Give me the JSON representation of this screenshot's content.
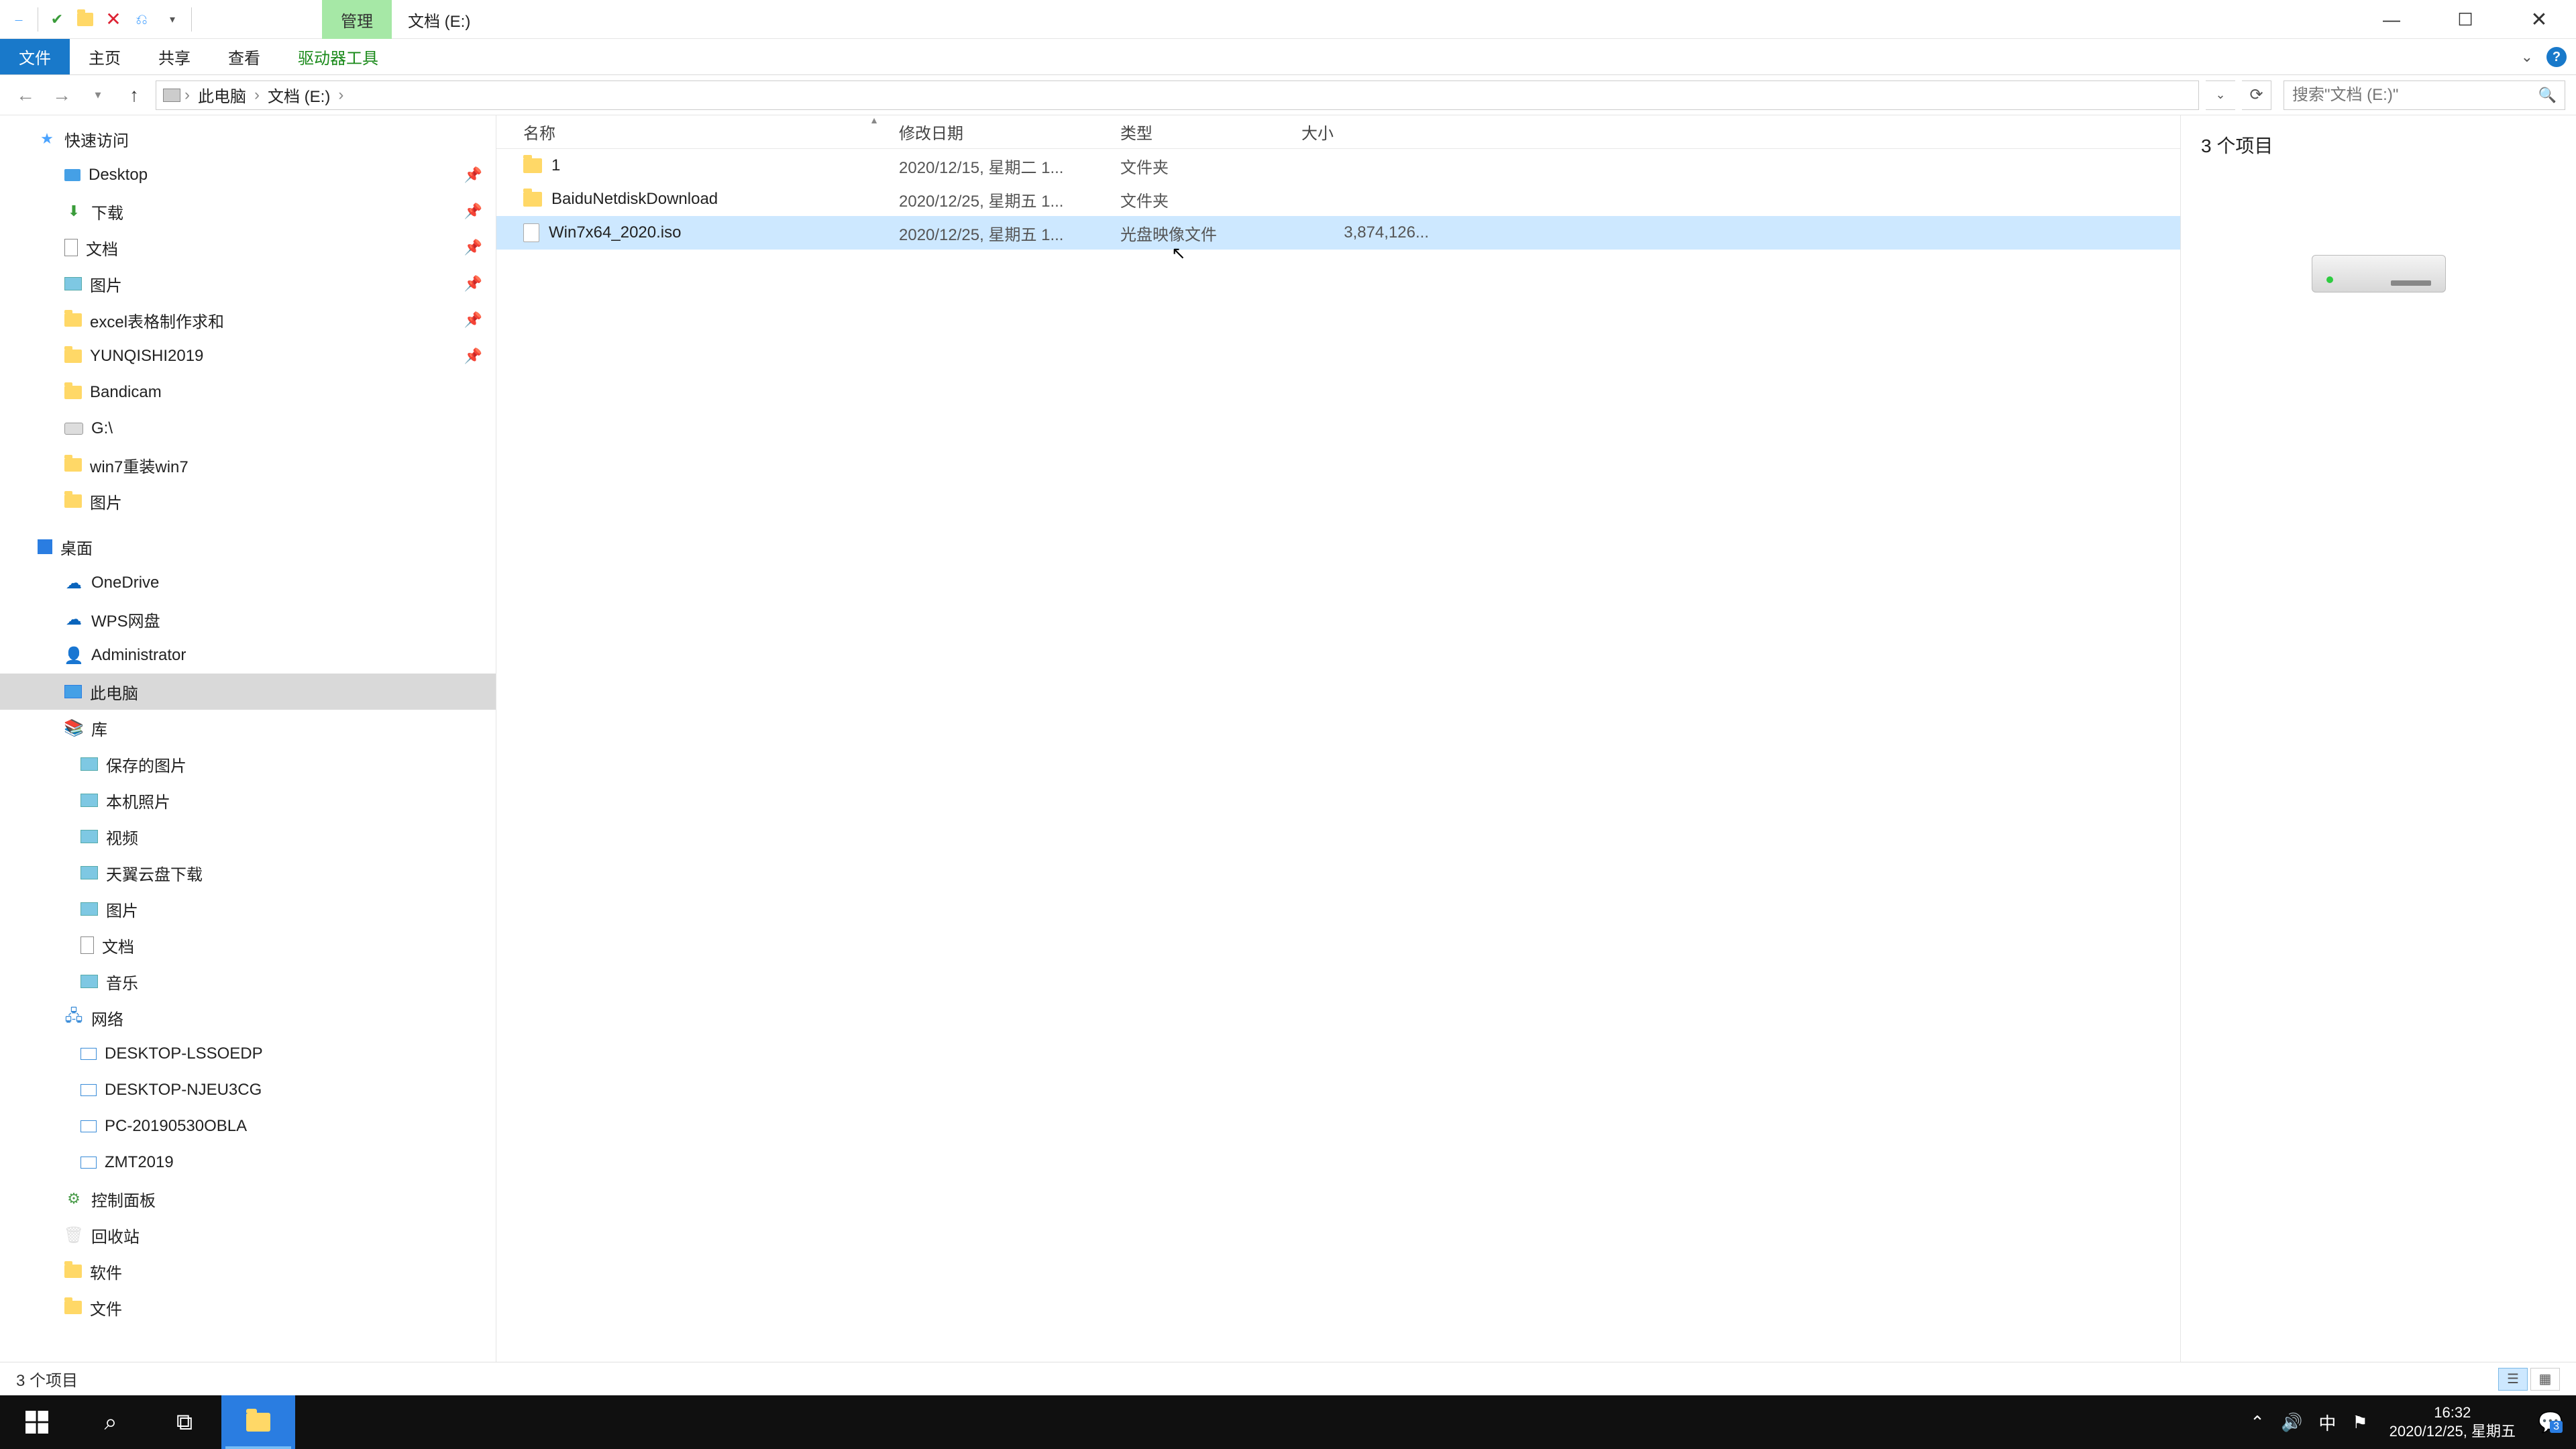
{
  "titlebar": {
    "manage_tab": "管理",
    "location": "文档 (E:)"
  },
  "ribbon": {
    "file": "文件",
    "home": "主页",
    "share": "共享",
    "view": "查看",
    "drive_tools": "驱动器工具"
  },
  "breadcrumb": {
    "pc": "此电脑",
    "drive": "文档 (E:)"
  },
  "search": {
    "placeholder": "搜索\"文档 (E:)\""
  },
  "columns": {
    "name": "名称",
    "date": "修改日期",
    "type": "类型",
    "size": "大小"
  },
  "files": [
    {
      "name": "1",
      "date": "2020/12/15, 星期二 1...",
      "type": "文件夹",
      "size": "",
      "icon": "folder",
      "selected": false
    },
    {
      "name": "BaiduNetdiskDownload",
      "date": "2020/12/25, 星期五 1...",
      "type": "文件夹",
      "size": "",
      "icon": "folder",
      "selected": false
    },
    {
      "name": "Win7x64_2020.iso",
      "date": "2020/12/25, 星期五 1...",
      "type": "光盘映像文件",
      "size": "3,874,126...",
      "icon": "iso",
      "selected": true
    }
  ],
  "tree": {
    "quick_access": "快速访问",
    "quick_items": [
      {
        "label": "Desktop",
        "icon": "desk",
        "pin": true
      },
      {
        "label": "下载",
        "icon": "down",
        "pin": true
      },
      {
        "label": "文档",
        "icon": "doc",
        "pin": true
      },
      {
        "label": "图片",
        "icon": "pic",
        "pin": true
      },
      {
        "label": "excel表格制作求和",
        "icon": "fld",
        "pin": true
      },
      {
        "label": "YUNQISHI2019",
        "icon": "fld",
        "pin": true
      },
      {
        "label": "Bandicam",
        "icon": "fld",
        "pin": false
      },
      {
        "label": "G:\\",
        "icon": "drv",
        "pin": false
      },
      {
        "label": "win7重装win7",
        "icon": "fld",
        "pin": false
      },
      {
        "label": "图片",
        "icon": "fld",
        "pin": false
      }
    ],
    "desktop": "桌面",
    "onedrive": "OneDrive",
    "wps": "WPS网盘",
    "admin": "Administrator",
    "this_pc": "此电脑",
    "libraries": "库",
    "lib_items": [
      {
        "label": "保存的图片",
        "icon": "pic"
      },
      {
        "label": "本机照片",
        "icon": "pic"
      },
      {
        "label": "视频",
        "icon": "pic"
      },
      {
        "label": "天翼云盘下载",
        "icon": "pic"
      },
      {
        "label": "图片",
        "icon": "pic"
      },
      {
        "label": "文档",
        "icon": "doc"
      },
      {
        "label": "音乐",
        "icon": "pic"
      }
    ],
    "network": "网络",
    "net_items": [
      "DESKTOP-LSSOEDP",
      "DESKTOP-NJEU3CG",
      "PC-20190530OBLA",
      "ZMT2019"
    ],
    "control_panel": "控制面板",
    "recycle": "回收站",
    "software": "软件",
    "wenjian": "文件"
  },
  "preview": {
    "count": "3 个项目"
  },
  "status": {
    "text": "3 个项目"
  },
  "taskbar": {
    "time": "16:32",
    "date": "2020/12/25, 星期五",
    "ime": "中",
    "notif_count": "3"
  }
}
